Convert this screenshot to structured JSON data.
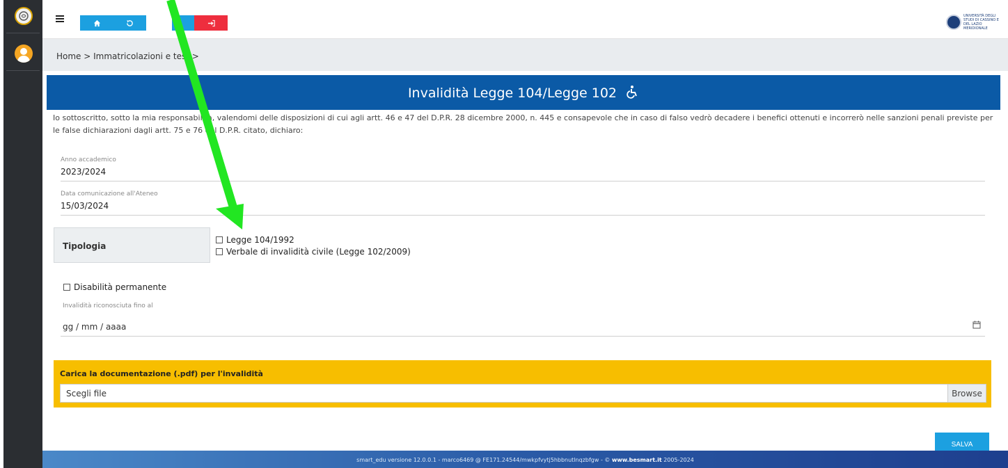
{
  "topbar": {
    "home_icon": "home-icon",
    "history_icon": "history-icon",
    "logout_icon": "logout-icon",
    "university_logo_text": "UNIVERSITÀ DEGLI STUDI DI CASSINO E DEL LAZIO MERIDIONALE"
  },
  "breadcrumb": "Home > Immatricolazioni e test >",
  "card": {
    "title": "Invalidità Legge 104/Legge 102",
    "intro": "Io sottoscritto, sotto la mia responsabilità, valendomi delle disposizioni di cui agli artt. 46 e 47 del D.P.R. 28 dicembre 2000, n. 445 e consapevole che in caso di falso vedrò decadere i benefici ottenuti e incorrerò nelle sanzioni penali previste per le false dichiarazioni dagli artt. 75 e 76 del D.P.R. citato, dichiaro:",
    "anno_label": "Anno accademico",
    "anno_value": "2023/2024",
    "data_label": "Data comunicazione all'Ateneo",
    "data_value": "15/03/2024",
    "tipologia_label": "Tipologia",
    "option_104": "Legge 104/1992",
    "option_102": "Verbale di invalidità civile (Legge 102/2009)",
    "permanente_label": "Disabilità permanente",
    "fino_label": "Invalidità riconosciuta fino al",
    "date_placeholder": "gg / mm / aaaa",
    "upload_title": "Carica la documentazione (.pdf) per l'invalidità",
    "file_placeholder": "Scegli file",
    "browse_label": "Browse",
    "save_label": "SALVA"
  },
  "footer": {
    "version": "smart_edu versione 12.0.0.1 - marco6469 @ FE171.24544/mwkpfvytj5hbbnutlnqzbfgw - ©",
    "site": "www.besmart.it",
    "years": "2005-2024"
  },
  "colors": {
    "header_blue": "#0b5aa6",
    "button_blue": "#1ca0e0",
    "logout_red": "#ee2e3e",
    "upload_yellow": "#f7be00",
    "annotation_arrow": "#22e622"
  }
}
